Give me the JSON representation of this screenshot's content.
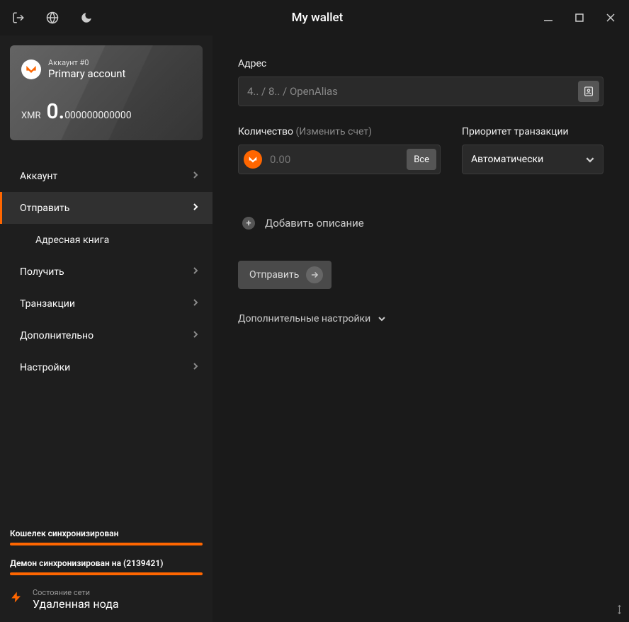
{
  "titlebar": {
    "title": "My wallet"
  },
  "account": {
    "number_label": "Аккаунт #0",
    "name": "Primary account",
    "currency": "XMR",
    "balance_int": "0.",
    "balance_dec": "000000000000"
  },
  "nav": {
    "items": [
      {
        "label": "Аккаунт"
      },
      {
        "label": "Отправить"
      },
      {
        "label": "Получить"
      },
      {
        "label": "Транзакции"
      },
      {
        "label": "Дополнительно"
      },
      {
        "label": "Настройки"
      }
    ],
    "sub_send": {
      "address_book": "Адресная книга"
    }
  },
  "sync": {
    "wallet": "Кошелек синхронизирован",
    "daemon": "Демон синхронизирован на (2139421)"
  },
  "network": {
    "status_label": "Состояние сети",
    "status_value": "Удаленная нода"
  },
  "send_form": {
    "address_label": "Адрес",
    "address_placeholder": "4.. / 8.. / OpenAlias",
    "amount_label": "Количество",
    "amount_sub": "(Изменить счет)",
    "amount_placeholder": "0.00",
    "all_button": "Все",
    "priority_label": "Приоритет транзакции",
    "priority_value": "Автоматически",
    "add_description": "Добавить описание",
    "send_button": "Отправить",
    "advanced_toggle": "Дополнительные настройки"
  }
}
